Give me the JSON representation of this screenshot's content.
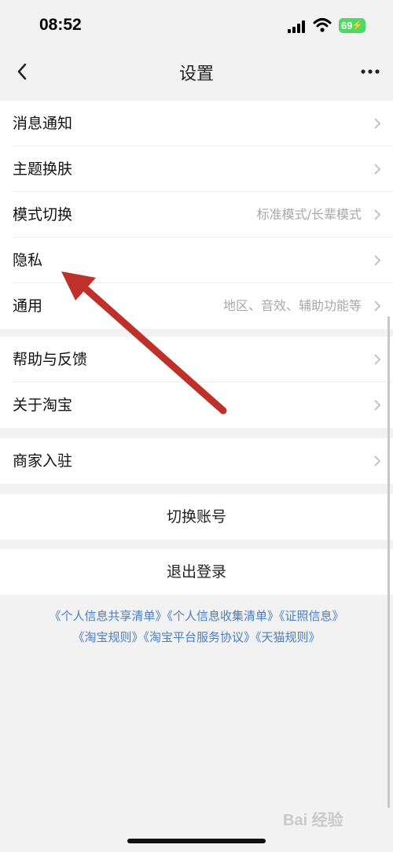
{
  "status_bar": {
    "time": "08:52",
    "battery": "69"
  },
  "nav": {
    "title": "设置"
  },
  "groups": {
    "g1": [
      {
        "label": "消息通知",
        "value": ""
      },
      {
        "label": "主题换肤",
        "value": ""
      },
      {
        "label": "模式切换",
        "value": "标准模式/长辈模式"
      },
      {
        "label": "隐私",
        "value": ""
      },
      {
        "label": "通用",
        "value": "地区、音效、辅助功能等"
      }
    ],
    "g2": [
      {
        "label": "帮助与反馈",
        "value": ""
      },
      {
        "label": "关于淘宝",
        "value": ""
      }
    ],
    "g3": [
      {
        "label": "商家入驻",
        "value": ""
      }
    ]
  },
  "actions": {
    "switch_account": "切换账号",
    "logout": "退出登录"
  },
  "links": [
    "《个人信息共享清单》",
    "《个人信息收集清单》",
    "《证照信息》",
    "《淘宝规则》",
    "《淘宝平台服务协议》",
    "《天猫规则》"
  ],
  "watermark": "Bai 经验",
  "colors": {
    "accent_link": "#4a7ec2",
    "annotation_arrow": "#c0302b",
    "battery": "#4cd964"
  }
}
